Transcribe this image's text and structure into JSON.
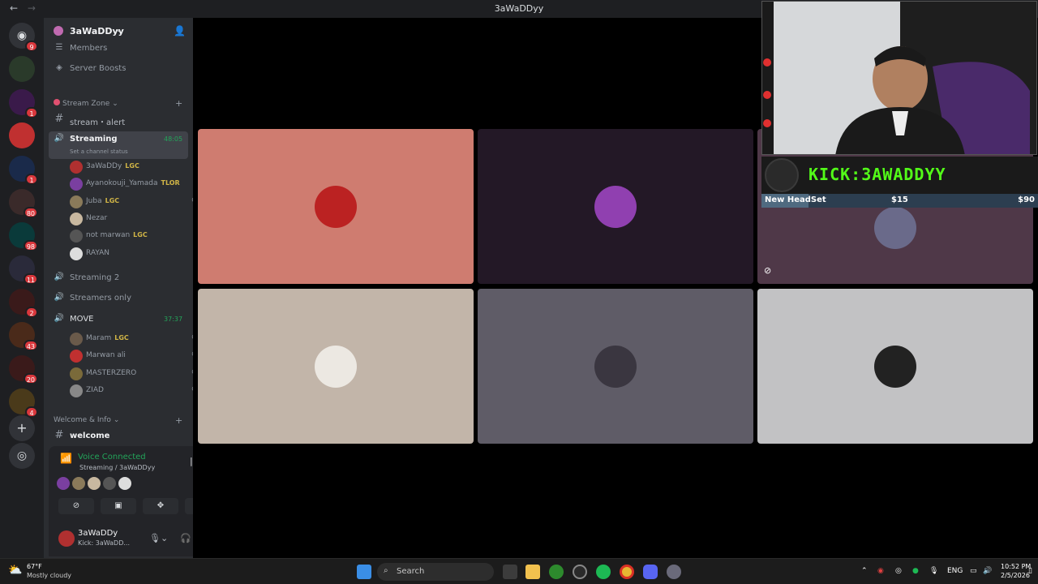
{
  "window": {
    "title": "3aWaDDyy",
    "back": "←",
    "forward": "→"
  },
  "servers": [
    {
      "badge": "9"
    },
    {
      "badge": ""
    },
    {
      "badge": "1"
    },
    {
      "badge": ""
    },
    {
      "badge": "1"
    },
    {
      "badge": "80"
    },
    {
      "badge": "98"
    },
    {
      "badge": "11"
    },
    {
      "badge": "2"
    },
    {
      "badge": "43"
    },
    {
      "badge": "20"
    },
    {
      "badge": "4"
    }
  ],
  "server": {
    "name": "3aWaDDyy"
  },
  "nav": {
    "members": "Members",
    "boosts": "Server Boosts"
  },
  "categories": {
    "stream_zone": "Stream Zone",
    "welcome_info": "Welcome & Info"
  },
  "channels": {
    "stream_alert": "stream・alert",
    "streaming": "Streaming",
    "streaming_timer": "48:05",
    "streaming_status": "Set a channel status",
    "streaming2": "Streaming 2",
    "streamers_only": "Streamers only",
    "move": "MOVE",
    "move_timer": "37:37",
    "welcome": "welcome"
  },
  "streaming_users": [
    {
      "name": "3aWaDDy",
      "tag": "LGC",
      "color": "#b03030"
    },
    {
      "name": "Ayanokouji_Yamada",
      "tag": "TLOR",
      "color": "#7a3fa0"
    },
    {
      "name": "Juba",
      "tag": "LGC",
      "color": "#8a7a5a"
    },
    {
      "name": "Nezar",
      "tag": "",
      "color": "#c8b8a0"
    },
    {
      "name": "not marwan",
      "tag": "LGC",
      "color": "#555"
    },
    {
      "name": "RAYAN",
      "tag": "",
      "color": "#ddd"
    }
  ],
  "move_users": [
    {
      "name": "Maram",
      "tag": "LGC",
      "color": "#6a5a4a"
    },
    {
      "name": "Marwan ali",
      "tag": "",
      "color": "#c03030"
    },
    {
      "name": "MASTERZERO",
      "tag": "",
      "color": "#7a6a3a"
    },
    {
      "name": "ZIAD",
      "tag": "",
      "color": "#888"
    }
  ],
  "voice": {
    "status": "Voice Connected",
    "channel": "Streaming / 3aWaDDyy"
  },
  "self": {
    "name": "3aWaDDy",
    "status": "Kick: 3aWaDD..."
  },
  "tiles": [
    {
      "bg": "#cf7c70",
      "avatar": "#b22"
    },
    {
      "bg": "#231826",
      "avatar": "#9040b0"
    },
    {
      "bg": "#4f3848",
      "avatar": "#6a6a8a"
    },
    {
      "bg": "#c2b5a9",
      "avatar": "#ece8e2"
    },
    {
      "bg": "#5f5c67",
      "avatar": "#3a3640"
    },
    {
      "bg": "#c2c2c4",
      "avatar": "#222"
    }
  ],
  "overlay": {
    "kick_text": "KICK:3AWADDYY",
    "goal_label": "New HeadSet",
    "goal_current": "$15",
    "goal_target": "$90",
    "goal_progress": 0.17
  },
  "taskbar": {
    "temp": "67°F",
    "weather": "Mostly cloudy",
    "search": "Search",
    "lang": "ENG",
    "time": "10:52 PM",
    "date": "2/5/2026"
  }
}
